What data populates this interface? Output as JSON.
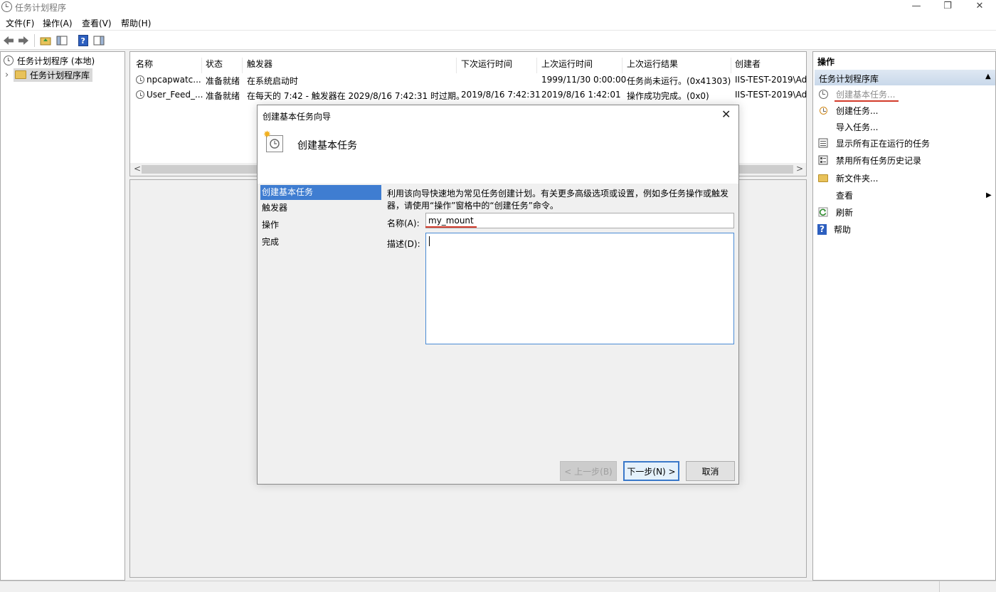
{
  "window": {
    "title": "任务计划程序",
    "minimize": "—",
    "restore": "❐",
    "close": "✕"
  },
  "menu": [
    "文件(F)",
    "操作(A)",
    "查看(V)",
    "帮助(H)"
  ],
  "tree": {
    "root": "任务计划程序 (本地)",
    "child": "任务计划程序库",
    "expander": "›"
  },
  "table": {
    "headers": [
      "名称",
      "状态",
      "触发器",
      "下次运行时间",
      "上次运行时间",
      "上次运行结果",
      "创建者"
    ],
    "rows": [
      [
        "npcapwatc...",
        "准备就绪",
        "在系统启动时",
        "",
        "1999/11/30 0:00:00",
        "任务尚未运行。(0x41303)",
        "IIS-TEST-2019\\Ad"
      ],
      [
        "User_Feed_...",
        "准备就绪",
        "在每天的 7:42 - 触发器在 2029/8/16 7:42:31 时过期。",
        "2019/8/16 7:42:31",
        "2019/8/16 1:42:01",
        "操作成功完成。(0x0)",
        "IIS-TEST-2019\\Ad"
      ]
    ],
    "scroll_left": "<",
    "scroll_right": ">"
  },
  "actions": {
    "heading": "操作",
    "section": "任务计划程序库",
    "collapse": "▲",
    "items": [
      "创建基本任务...",
      "创建任务...",
      "导入任务...",
      "显示所有正在运行的任务",
      "禁用所有任务历史记录",
      "新文件夹...",
      "查看",
      "刷新",
      "帮助"
    ],
    "submenu_arrow": "▶"
  },
  "dialog": {
    "title": "创建基本任务向导",
    "close": "✕",
    "header": "创建基本任务",
    "steps": [
      "创建基本任务",
      "触发器",
      "操作",
      "完成"
    ],
    "intro": "利用该向导快速地为常见任务创建计划。有关更多高级选项或设置，例如多任务操作或触发器，请使用“操作”窗格中的“创建任务”命令。",
    "name_label": "名称(A):",
    "name_value": "my_mount",
    "desc_label": "描述(D):",
    "desc_value": "",
    "back_button": "< 上一步(B)",
    "next_button": "下一步(N) >",
    "cancel_button": "取消"
  },
  "colors": {
    "selection": "#3f7dd1",
    "annotation_underline": "#d23a2a",
    "section_header": "#c9d8ea"
  }
}
